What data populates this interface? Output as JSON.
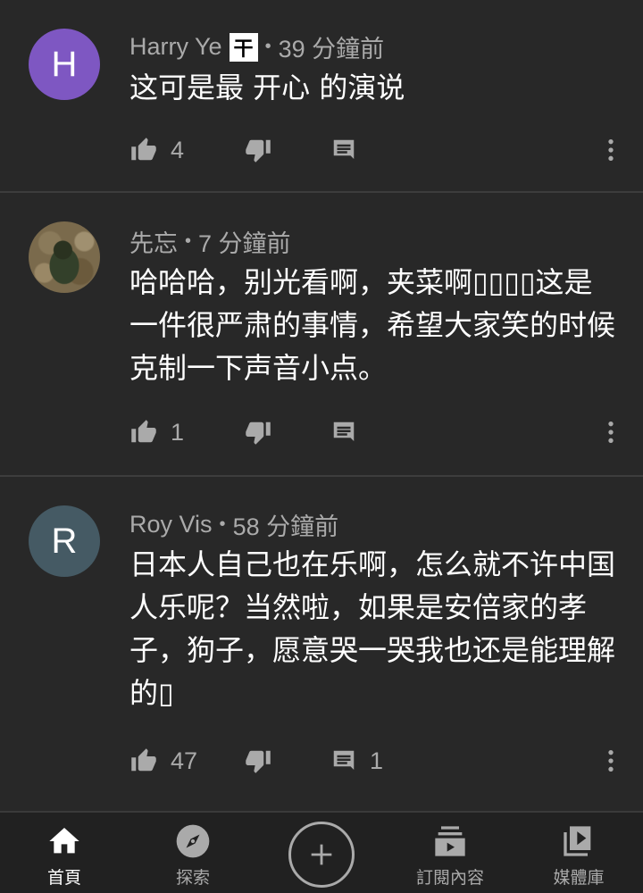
{
  "comments": [
    {
      "author": "Harry Ye",
      "flag": "干",
      "separator": "•",
      "time": "39 分鐘前",
      "avatar_letter": "H",
      "avatar_color": "#7e57c2",
      "text": "这可是最 开心 的演说",
      "likes": "4",
      "replies": ""
    },
    {
      "author": "先忘",
      "separator": "•",
      "time": "7 分鐘前",
      "avatar_letter": "",
      "text": "哈哈哈，别光看啊，夹菜啊▯▯▯▯这是一件很严肃的事情，希望大家笑的时候克制一下声音小点。",
      "likes": "1",
      "replies": ""
    },
    {
      "author": "Roy Vis",
      "separator": "•",
      "time": "58 分鐘前",
      "avatar_letter": "R",
      "avatar_color": "#455a64",
      "text": "日本人自己也在乐啊，怎么就不许中国人乐呢？当然啦，如果是安倍家的孝子，狗子，愿意哭一哭我也还是能理解的▯",
      "likes": "47",
      "replies": "1"
    }
  ],
  "bottom_nav": {
    "home": "首頁",
    "explore": "探索",
    "subscriptions": "訂閱內容",
    "library": "媒體庫"
  },
  "icons": {
    "like": "thumb-up-icon",
    "dislike": "thumb-down-icon",
    "reply": "comment-icon",
    "more": "more-vert-icon"
  }
}
